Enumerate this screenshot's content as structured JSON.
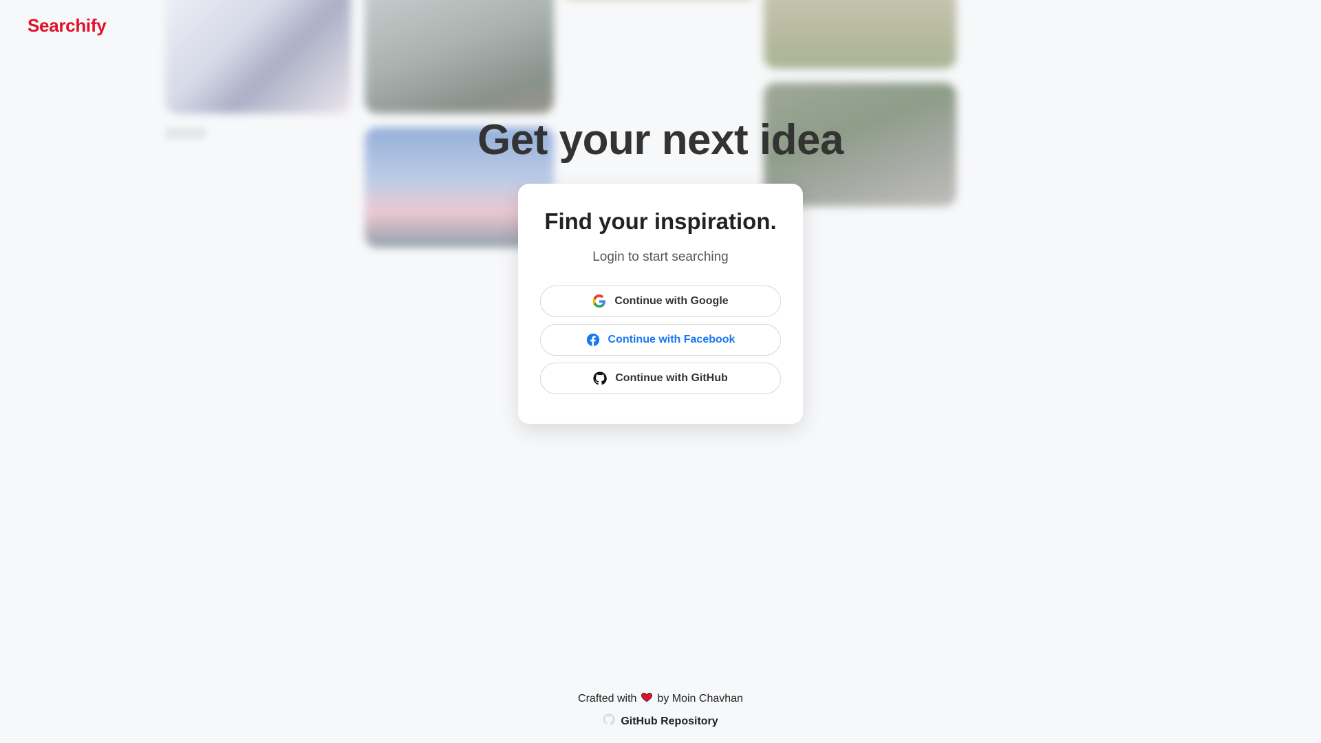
{
  "brand": {
    "name": "Searchify",
    "color": "#e0112b"
  },
  "hero": {
    "title": "Get your next idea"
  },
  "login_card": {
    "title": "Find your inspiration.",
    "subtitle": "Login to start searching",
    "buttons": [
      {
        "label": "Continue with Google",
        "icon": "google-icon"
      },
      {
        "label": "Continue with Facebook",
        "icon": "facebook-icon",
        "color": "#1877f2"
      },
      {
        "label": "Continue with GitHub",
        "icon": "github-icon"
      }
    ]
  },
  "footer": {
    "crafted_prefix": "Crafted with",
    "crafted_suffix": "by Moin Chavhan",
    "heart_icon": "heart-icon",
    "repo_label": "GitHub Repository",
    "repo_icon": "github-icon"
  }
}
